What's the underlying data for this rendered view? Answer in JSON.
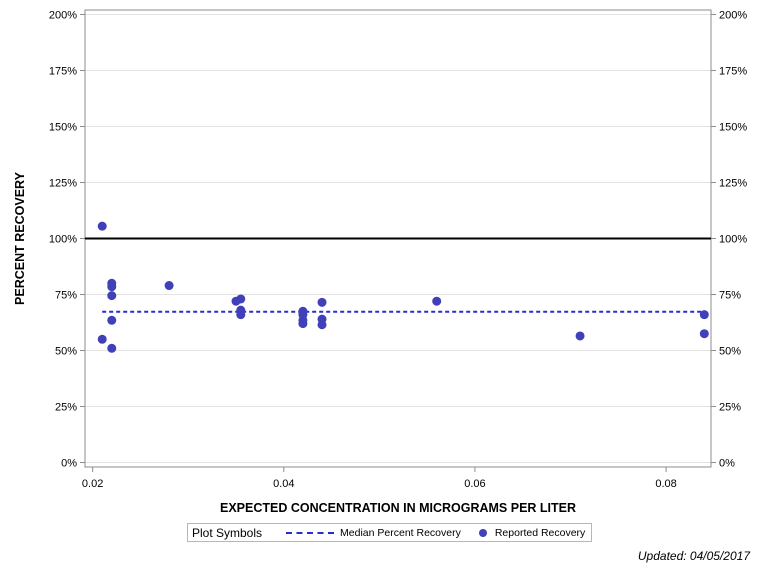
{
  "chart_data": {
    "type": "scatter",
    "xlabel": "EXPECTED CONCENTRATION IN MICROGRAMS PER LITER",
    "ylabel": "PERCENT RECOVERY",
    "xlim": [
      0.0192,
      0.0847
    ],
    "ylim": [
      -2,
      202
    ],
    "x_ticks": [
      0.02,
      0.04,
      0.06,
      0.08
    ],
    "x_tick_labels": [
      "0.02",
      "0.04",
      "0.06",
      "0.08"
    ],
    "y_ticks": [
      0,
      25,
      50,
      75,
      100,
      125,
      150,
      175,
      200
    ],
    "y_tick_labels": [
      "0%",
      "25%",
      "50%",
      "75%",
      "100%",
      "125%",
      "150%",
      "175%",
      "200%"
    ],
    "grid": true,
    "reference_line": {
      "y": 100
    },
    "median_line": {
      "y": 67.3,
      "x_range": [
        0.021,
        0.084
      ]
    },
    "legend": {
      "title": "Plot Symbols",
      "position": "bottom",
      "entries": [
        "Median Percent Recovery",
        "Reported Recovery"
      ]
    },
    "series": [
      {
        "name": "Reported Recovery",
        "color": "#4040b8",
        "points": [
          [
            0.021,
            105.5
          ],
          [
            0.021,
            55
          ],
          [
            0.022,
            80
          ],
          [
            0.022,
            78.5
          ],
          [
            0.022,
            74.5
          ],
          [
            0.022,
            63.5
          ],
          [
            0.022,
            51
          ],
          [
            0.028,
            79
          ],
          [
            0.035,
            72
          ],
          [
            0.0355,
            73
          ],
          [
            0.0355,
            68
          ],
          [
            0.0355,
            66
          ],
          [
            0.042,
            67.5
          ],
          [
            0.042,
            66
          ],
          [
            0.042,
            63.5
          ],
          [
            0.042,
            62
          ],
          [
            0.044,
            71.5
          ],
          [
            0.044,
            64
          ],
          [
            0.044,
            61.5
          ],
          [
            0.056,
            72
          ],
          [
            0.071,
            56.5
          ],
          [
            0.084,
            66
          ],
          [
            0.084,
            57.5
          ]
        ]
      }
    ]
  },
  "footer": {
    "updated": "Updated: 04/05/2017"
  }
}
